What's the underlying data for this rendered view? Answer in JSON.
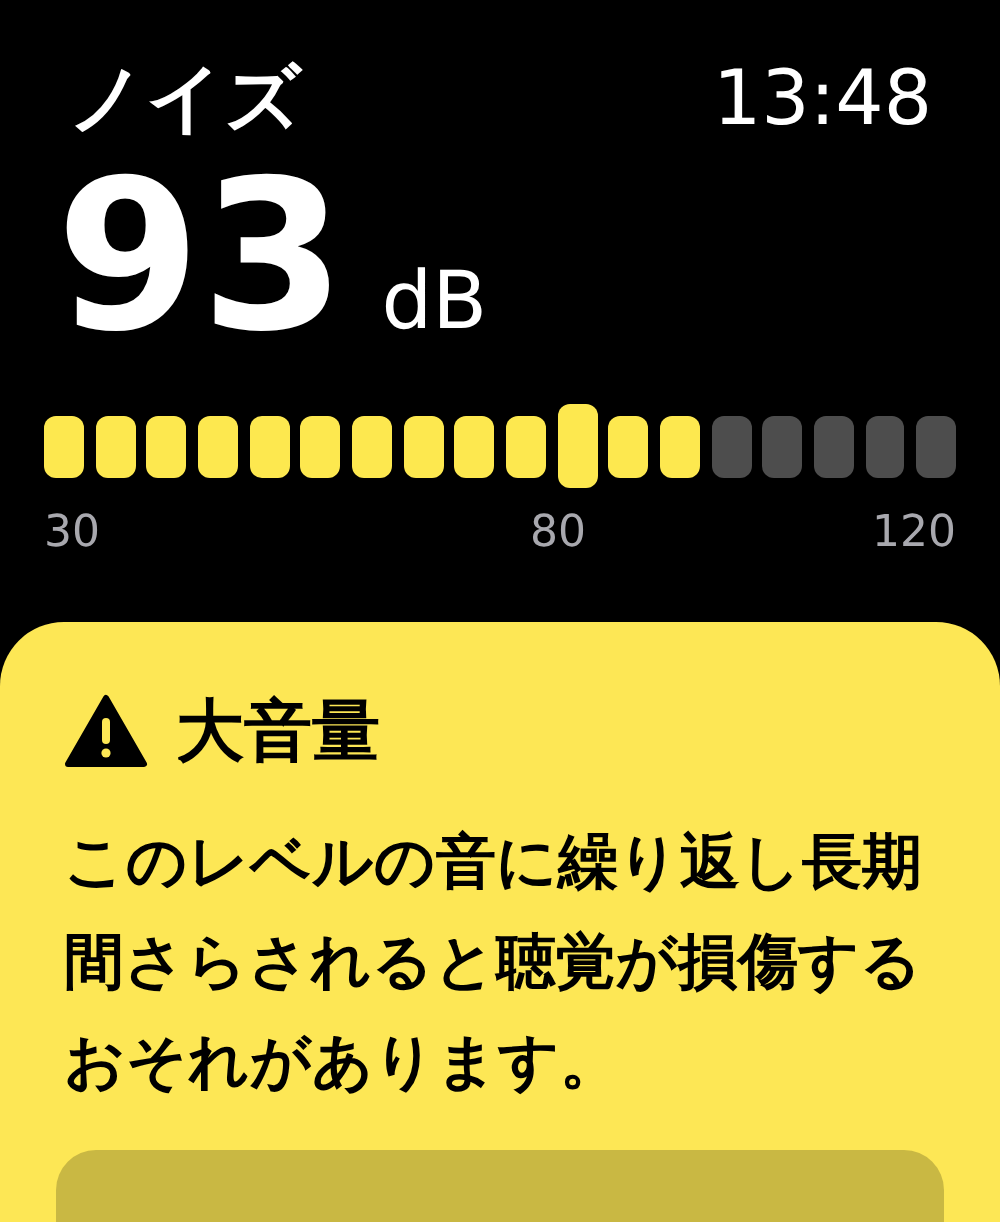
{
  "header": {
    "title": "ノイズ",
    "time": "13:48"
  },
  "reading": {
    "value": "93",
    "unit": "dB"
  },
  "meter": {
    "level": 0.722,
    "ticks": [
      "30",
      "80",
      "120"
    ]
  },
  "alert": {
    "title": "大音量",
    "message": "このレベルの音に繰り返し長期間さらされると聴覚が損傷するおそれがあります。"
  }
}
